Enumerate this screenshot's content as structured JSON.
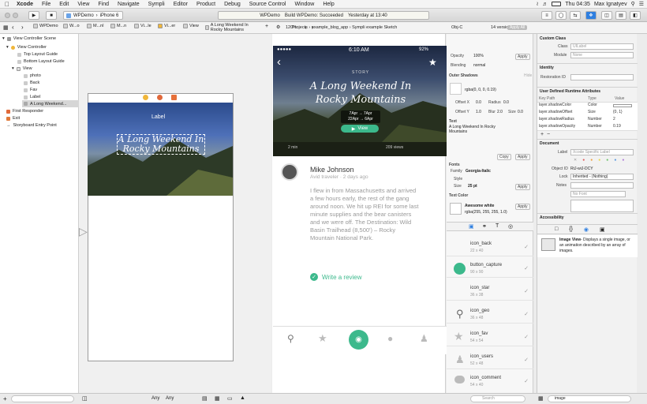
{
  "menubar": {
    "app": "Xcode",
    "items": [
      "File",
      "Edit",
      "View",
      "Find",
      "Navigate",
      "Sympli",
      "Editor",
      "Product",
      "Debug",
      "Source Control",
      "Window",
      "Help"
    ],
    "clock": "Thu 04:35",
    "user": "Max Ignatyev"
  },
  "toolbar": {
    "scheme": "WPDemo",
    "device": "iPhone 6",
    "status_app": "WPDemo",
    "status_text": "Build WPDemo: Succeeded",
    "status_time": "Yesterday at 13:40"
  },
  "jumpbar": {
    "crumbs": [
      "WPDemo",
      "W...o",
      "M...nl",
      "M...n",
      "Vi...le",
      "Vi...er",
      "View",
      "A Long Weekend In Rocky Mountains"
    ],
    "sim_zoom": "120%",
    "sim_path": "Projects › example_blog_app › Sympli example Sketch",
    "sketch_kind": "Obj-C",
    "sketch_versions": "14 versions",
    "apply_all": "Apply All"
  },
  "outline": {
    "items": [
      "View Controller Scene",
      "View Controller",
      "Top Layout Guide",
      "Bottom Layout Guide",
      "View",
      "photo",
      "Back",
      "Fav",
      "Label",
      "A Long Weekend...",
      "First Responder",
      "Exit",
      "Storyboard Entry Point"
    ]
  },
  "ib": {
    "label": "Label",
    "title": "A Long Weekend In Rocky Mountains"
  },
  "sim": {
    "carrier": "●●●●● ",
    "time": "6:10 AM",
    "battery": "92%",
    "story": "STORY",
    "title": "A Long Weekend In Rocky Mountains",
    "date1": "7Apr → 7Apr",
    "date2": "22Apr → 6Apr",
    "view_btn": "View",
    "duration": "2 min",
    "views": "209 views",
    "author": "Mike Johnson",
    "author_meta": "Avid traveler · 2 days ago",
    "body": "I flew in from Massachusetts and arrived a few hours early, the rest of the gang around noon. We hit up REI for some last minute supplies and the bear canisters and we were off. The Destination: Wild Basin Trailhead (8,500') – Rocky Mountain National Park.",
    "review": "Write a review"
  },
  "sketch": {
    "opacity_lbl": "Opacity",
    "opacity": "100%",
    "blending_lbl": "Blending",
    "blending": "normal",
    "apply": "Apply",
    "outer_shadows": "Outer Shadows",
    "shadow_color": "rgba(0, 0, 0, 0.19)",
    "offx_lbl": "Offset X",
    "offx": "0.0",
    "radius_lbl": "Radius",
    "radius": "0.0",
    "offy_lbl": "Offset Y",
    "offy": "1.0",
    "blur_lbl": "Blur",
    "blur": "2.0",
    "size_lbl": "Size",
    "size": "0.0",
    "hide": "Hide",
    "text_lbl": "Text",
    "text_val": "A Long Weekend In Rocky Mountains",
    "copy": "Copy",
    "fonts": "Fonts",
    "family_lbl": "Family",
    "family": "Georgia-Italic",
    "style_lbl": "Style",
    "size2_lbl": "Size",
    "size2": "25 pt",
    "text_color": "Text Color",
    "color_name": "Awesome white",
    "color_val": "rgba(255, 255, 255, 1.0)",
    "search": "Search",
    "assets": [
      {
        "name": "icon_back",
        "size": "22 x 40"
      },
      {
        "name": "button_capture",
        "size": "90 x 90"
      },
      {
        "name": "icon_star",
        "size": "36 x 38"
      },
      {
        "name": "icon_geo",
        "size": "36 x 48"
      },
      {
        "name": "icon_fav",
        "size": "54 x 54"
      },
      {
        "name": "icon_users",
        "size": "52 x 48"
      },
      {
        "name": "icon_comment",
        "size": "54 x 40"
      }
    ]
  },
  "inspector": {
    "custom_class": "Custom Class",
    "class_lbl": "Class",
    "class_ph": "UILabel",
    "module_lbl": "Module",
    "module_ph": "None",
    "identity": "Identity",
    "restoration_lbl": "Restoration ID",
    "udra": "User Defined Runtime Attributes",
    "col_key": "Key Path",
    "col_type": "Type",
    "col_value": "Value",
    "rows": [
      {
        "k": "layer.shadowColor",
        "t": "Color",
        "v": ""
      },
      {
        "k": "layer.shadowOffset",
        "t": "Size",
        "v": "{0, 1}"
      },
      {
        "k": "layer.shadowRadius",
        "t": "Number",
        "v": "2"
      },
      {
        "k": "layer.shadowOpacity",
        "t": "Number",
        "v": "0.19"
      }
    ],
    "document": "Document",
    "label_lbl": "Label",
    "label_ph": "Xcode Specific Label",
    "objid_lbl": "Object ID",
    "objid": "RtJ-wiJ-DCY",
    "lock_lbl": "Lock",
    "lock": "Inherited - (Nothing)",
    "notes_lbl": "Notes",
    "font_ph": "No Font",
    "accessibility": "Accessibility",
    "imgview_title": "Image View",
    "imgview_desc": "- Displays a single image, or an animation described by an array of images.",
    "bottom_filter": "image"
  },
  "bottom": {
    "any1": "Any",
    "any2": "Any"
  },
  "colors": {
    "accent": "#3cb98c",
    "xcode_blue": "#2f7fe0"
  }
}
